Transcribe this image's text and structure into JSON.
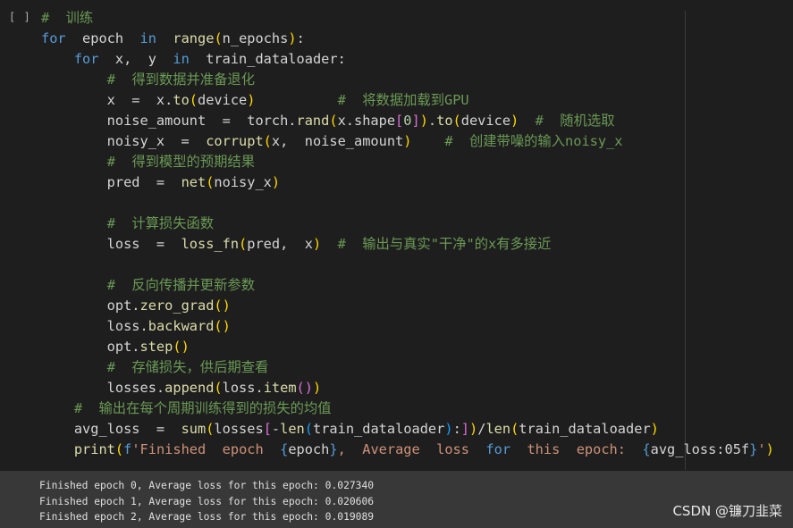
{
  "cell": {
    "run_indicator": "[ ]",
    "code_lines": [
      [
        [
          "cm",
          "#  训练"
        ]
      ],
      [
        [
          "kw",
          "for"
        ],
        [
          "",
          "  epoch  "
        ],
        [
          "kw",
          "in"
        ],
        [
          "",
          "  "
        ],
        [
          "fn",
          "range"
        ],
        [
          "br1",
          "("
        ],
        [
          "",
          "n_epochs"
        ],
        [
          "br1",
          ")"
        ],
        [
          "",
          ":"
        ]
      ],
      [
        [
          "",
          "    "
        ],
        [
          "kw",
          "for"
        ],
        [
          "",
          "  x,  y  "
        ],
        [
          "kw",
          "in"
        ],
        [
          "",
          "  train_dataloader:"
        ]
      ],
      [
        [
          "",
          "        "
        ],
        [
          "cm",
          "#  得到数据并准备退化"
        ]
      ],
      [
        [
          "",
          "        x  =  x."
        ],
        [
          "fn",
          "to"
        ],
        [
          "br1",
          "("
        ],
        [
          "",
          "device"
        ],
        [
          "br1",
          ")"
        ],
        [
          "",
          "          "
        ],
        [
          "cm",
          "#  将数据加载到GPU"
        ]
      ],
      [
        [
          "",
          "        noise_amount  =  torch."
        ],
        [
          "fn",
          "rand"
        ],
        [
          "br1",
          "("
        ],
        [
          "",
          "x.shape"
        ],
        [
          "br2",
          "["
        ],
        [
          "nm",
          "0"
        ],
        [
          "br2",
          "]"
        ],
        [
          "br1",
          ")"
        ],
        [
          "",
          "."
        ],
        [
          "fn",
          "to"
        ],
        [
          "br1",
          "("
        ],
        [
          "",
          "device"
        ],
        [
          "br1",
          ")"
        ],
        [
          "",
          "  "
        ],
        [
          "cm",
          "#  随机选取"
        ]
      ],
      [
        [
          "",
          "        noisy_x  =  "
        ],
        [
          "fn",
          "corrupt"
        ],
        [
          "br1",
          "("
        ],
        [
          "",
          "x,  noise_amount"
        ],
        [
          "br1",
          ")"
        ],
        [
          "",
          "    "
        ],
        [
          "cm",
          "#  创建带噪的输入noisy_x"
        ]
      ],
      [
        [
          "",
          "        "
        ],
        [
          "cm",
          "#  得到模型的预期结果"
        ]
      ],
      [
        [
          "",
          "        pred  =  "
        ],
        [
          "fn",
          "net"
        ],
        [
          "br1",
          "("
        ],
        [
          "",
          "noisy_x"
        ],
        [
          "br1",
          ")"
        ]
      ],
      [
        [
          "",
          ""
        ]
      ],
      [
        [
          "",
          "        "
        ],
        [
          "cm",
          "#  计算损失函数"
        ]
      ],
      [
        [
          "",
          "        loss  =  "
        ],
        [
          "fn",
          "loss_fn"
        ],
        [
          "br1",
          "("
        ],
        [
          "",
          "pred,  x"
        ],
        [
          "br1",
          ")"
        ],
        [
          "",
          "  "
        ],
        [
          "cm",
          "#  输出与真实\"干净\"的x有多接近"
        ]
      ],
      [
        [
          "",
          ""
        ]
      ],
      [
        [
          "",
          "        "
        ],
        [
          "cm",
          "#  反向传播并更新参数"
        ]
      ],
      [
        [
          "",
          "        opt."
        ],
        [
          "fn",
          "zero_grad"
        ],
        [
          "br1",
          "()"
        ]
      ],
      [
        [
          "",
          "        loss."
        ],
        [
          "fn",
          "backward"
        ],
        [
          "br1",
          "()"
        ]
      ],
      [
        [
          "",
          "        opt."
        ],
        [
          "fn",
          "step"
        ],
        [
          "br1",
          "()"
        ]
      ],
      [
        [
          "",
          "        "
        ],
        [
          "cm",
          "#  存储损失，供后期查看"
        ]
      ],
      [
        [
          "",
          "        losses."
        ],
        [
          "fn",
          "append"
        ],
        [
          "br1",
          "("
        ],
        [
          "",
          "loss."
        ],
        [
          "fn",
          "item"
        ],
        [
          "br2",
          "()"
        ],
        [
          "br1",
          ")"
        ]
      ],
      [
        [
          "",
          "    "
        ],
        [
          "cm",
          "#  输出在每个周期训练得到的损失的均值"
        ]
      ],
      [
        [
          "",
          "    avg_loss  =  "
        ],
        [
          "fn",
          "sum"
        ],
        [
          "br1",
          "("
        ],
        [
          "",
          "losses"
        ],
        [
          "br2",
          "["
        ],
        [
          "",
          "-"
        ],
        [
          "fn",
          "len"
        ],
        [
          "br3",
          "("
        ],
        [
          "",
          "train_dataloader"
        ],
        [
          "br3",
          ")"
        ],
        [
          "",
          ":"
        ],
        [
          "br2",
          "]"
        ],
        [
          "br1",
          ")"
        ],
        [
          "",
          "/"
        ],
        [
          "fn",
          "len"
        ],
        [
          "br1",
          "("
        ],
        [
          "",
          "train_dataloader"
        ],
        [
          "br1",
          ")"
        ]
      ],
      [
        [
          "",
          "    "
        ],
        [
          "fn",
          "print"
        ],
        [
          "br1",
          "("
        ],
        [
          "kw",
          "f"
        ],
        [
          "st",
          "'Finished  epoch  "
        ],
        [
          "kw",
          "{"
        ],
        [
          "",
          "epoch"
        ],
        [
          "kw",
          "}"
        ],
        [
          "st",
          ",  Average  loss  "
        ],
        [
          "kw",
          "for"
        ],
        [
          "st",
          "  this  epoch:  "
        ],
        [
          "kw",
          "{"
        ],
        [
          "",
          "avg_loss:05f"
        ],
        [
          "kw",
          "}"
        ],
        [
          "st",
          "'"
        ],
        [
          "br1",
          ")"
        ]
      ]
    ]
  },
  "output": {
    "lines": [
      "Finished epoch 0, Average loss for this epoch: 0.027340",
      "Finished epoch 1, Average loss for this epoch: 0.020606",
      "Finished epoch 2, Average loss for this epoch: 0.019089"
    ]
  },
  "watermark": "CSDN @镰刀韭菜"
}
